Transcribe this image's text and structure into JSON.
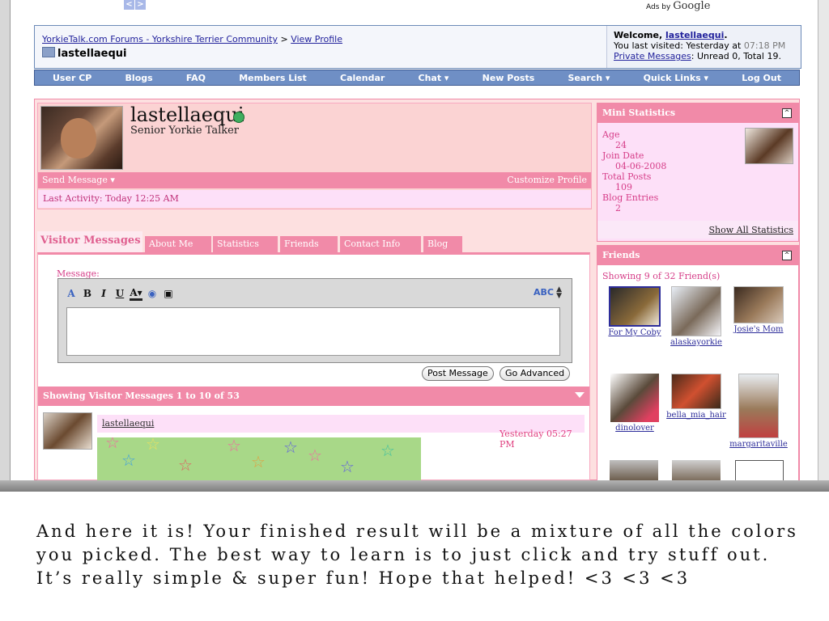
{
  "top": {
    "ads_label": "Ads by",
    "ads_brand": "Google"
  },
  "breadcrumb": {
    "site": "YorkieTalk.com Forums - Yorkshire Terrier Community",
    "sep": ">",
    "page": "View Profile",
    "current": "lastellaequi"
  },
  "welcome": {
    "greeting": "Welcome,",
    "user": "lastellaequi",
    "visited_label": "You last visited: Yesterday at",
    "visited_time": "07:18 PM",
    "pm_link": "Private Messages",
    "pm_status": ": Unread 0, Total 19."
  },
  "menu": [
    "User CP",
    "Blogs",
    "FAQ",
    "Members List",
    "Calendar",
    "Chat ▾",
    "New Posts",
    "Search ▾",
    "Quick Links ▾",
    "Log Out"
  ],
  "profile": {
    "username": "lastellaequi",
    "user_title": "Senior Yorkie Talker",
    "send_message": "Send Message ▾",
    "customize": "Customize Profile",
    "last_activity": "Last Activity: Today 12:25 AM"
  },
  "tabs": {
    "active": "Visitor Messages",
    "others": [
      "About Me",
      "Statistics",
      "Friends",
      "Contact Info",
      "Blog"
    ]
  },
  "composer": {
    "label": "Message:",
    "post_button": "Post Message",
    "advanced_button": "Go Advanced",
    "spell": "ABC"
  },
  "messages": {
    "header": "Showing Visitor Messages 1 to 10 of 53",
    "author": "lastellaequi",
    "time": "Yesterday 05:27 PM"
  },
  "mini_stats": {
    "title": "Mini Statistics",
    "age_label": "Age",
    "age": "24",
    "join_label": "Join Date",
    "join": "04-06-2008",
    "posts_label": "Total Posts",
    "posts": "109",
    "blog_label": "Blog Entries",
    "blog": "2",
    "show_all": "Show All Statistics"
  },
  "friends": {
    "title": "Friends",
    "count": "Showing 9 of 32 Friend(s)",
    "names": [
      "For My Coby",
      "alaskayorkie",
      "Josie's Mom",
      "dinolover",
      "bella_mia_hair",
      "margaritaville"
    ]
  },
  "caption": {
    "line1": "And here it is! Your finished result will be a mixture of all the colors",
    "line2": "you picked. The best way to learn is to just click and try stuff out.",
    "line3": "It’s really simple & super fun! Hope that helped! <3 <3 <3"
  }
}
